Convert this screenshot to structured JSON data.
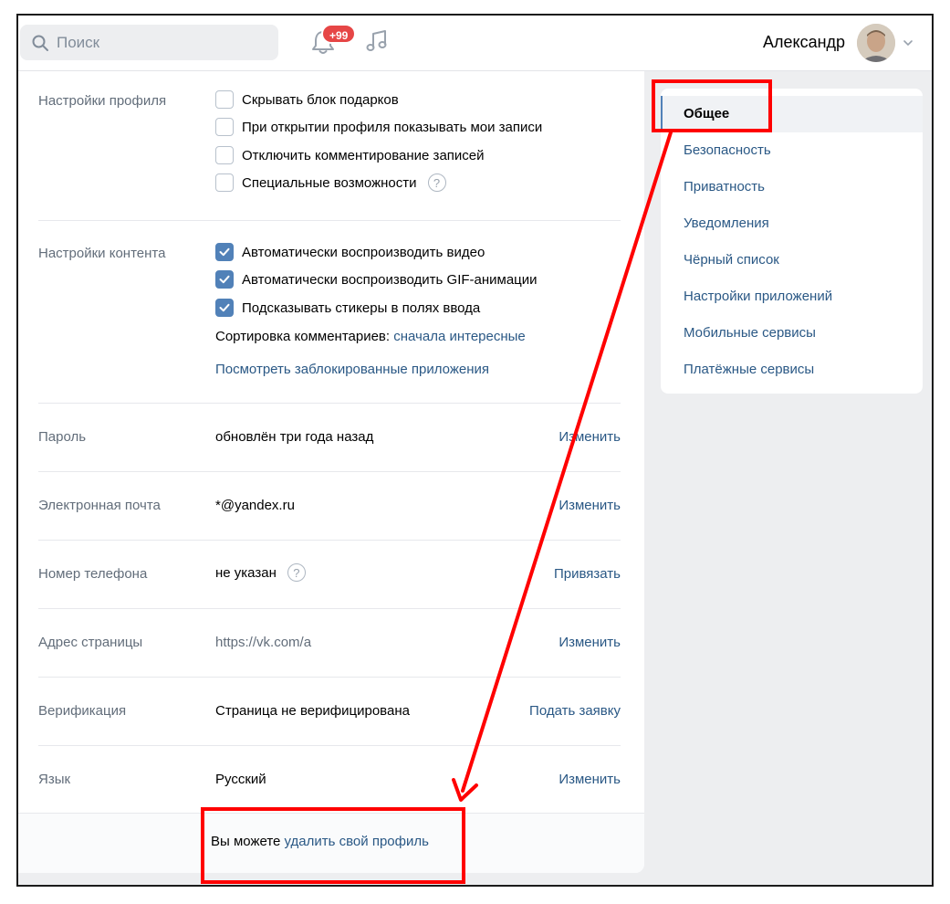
{
  "header": {
    "search_placeholder": "Поиск",
    "notification_badge": "+99",
    "user_name": "Александр"
  },
  "profile_settings": {
    "label": "Настройки профиля",
    "options": [
      {
        "text": "Скрывать блок подарков",
        "checked": false
      },
      {
        "text": "При открытии профиля показывать мои записи",
        "checked": false
      },
      {
        "text": "Отключить комментирование записей",
        "checked": false
      },
      {
        "text": "Специальные возможности",
        "checked": false
      }
    ],
    "help_symbol": "?"
  },
  "content_settings": {
    "label": "Настройки контента",
    "options": [
      {
        "text": "Автоматически воспроизводить видео",
        "checked": true
      },
      {
        "text": "Автоматически воспроизводить GIF-анимации",
        "checked": true
      },
      {
        "text": "Подсказывать стикеры в полях ввода",
        "checked": true
      }
    ],
    "sort_label": "Сортировка комментариев:",
    "sort_value": "сначала интересные",
    "blocked_apps_link": "Посмотреть заблокированные приложения"
  },
  "rows": [
    {
      "label": "Пароль",
      "value": "обновлён три года назад",
      "action": "Изменить"
    },
    {
      "label": "Электронная почта",
      "value": "*@yandex.ru",
      "action": "Изменить"
    },
    {
      "label": "Номер телефона",
      "value": "не указан",
      "action": "Привязать"
    },
    {
      "label": "Адрес страницы",
      "value": "https://vk.com/a",
      "action": "Изменить"
    },
    {
      "label": "Верификация",
      "value": "Страница не верифицирована",
      "action": "Подать заявку"
    },
    {
      "label": "Язык",
      "value": "Русский",
      "action": "Изменить"
    }
  ],
  "footer": {
    "prefix": "Вы можете",
    "link": "удалить свой профиль"
  },
  "side_nav": {
    "items": [
      {
        "label": "Общее",
        "active": true
      },
      {
        "label": "Безопасность"
      },
      {
        "label": "Приватность"
      },
      {
        "label": "Уведомления"
      },
      {
        "label": "Чёрный список"
      },
      {
        "label": "Настройки приложений"
      },
      {
        "label": "Мобильные сервисы"
      },
      {
        "label": "Платёжные сервисы"
      }
    ]
  },
  "colors": {
    "link": "#2a5885",
    "checkbox_on": "#5181b8",
    "annotation": "#ff0000",
    "badge": "#e64646"
  }
}
